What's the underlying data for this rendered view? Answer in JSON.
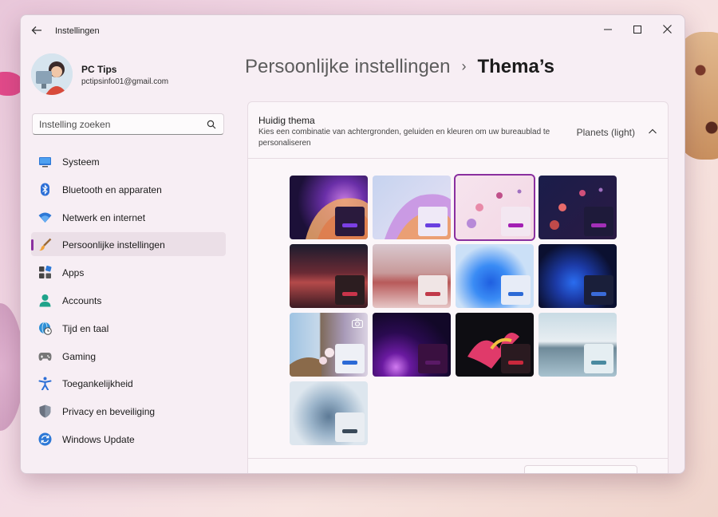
{
  "window": {
    "title": "Instellingen"
  },
  "profile": {
    "name": "PC Tips",
    "email": "pctipsinfo01@gmail.com"
  },
  "search": {
    "placeholder": "Instelling zoeken"
  },
  "nav": {
    "items": [
      {
        "label": "Systeem",
        "icon": "monitor-icon"
      },
      {
        "label": "Bluetooth en apparaten",
        "icon": "bluetooth-icon"
      },
      {
        "label": "Netwerk en internet",
        "icon": "wifi-icon"
      },
      {
        "label": "Persoonlijke instellingen",
        "icon": "brush-icon",
        "active": true
      },
      {
        "label": "Apps",
        "icon": "apps-icon"
      },
      {
        "label": "Accounts",
        "icon": "person-icon"
      },
      {
        "label": "Tijd en taal",
        "icon": "globe-clock-icon"
      },
      {
        "label": "Gaming",
        "icon": "gamepad-icon"
      },
      {
        "label": "Toegankelijkheid",
        "icon": "accessibility-icon"
      },
      {
        "label": "Privacy en beveiliging",
        "icon": "shield-icon"
      },
      {
        "label": "Windows Update",
        "icon": "update-icon"
      }
    ]
  },
  "breadcrumb": {
    "parent": "Persoonlijke instellingen",
    "separator": "›",
    "current": "Thema’s"
  },
  "current_theme": {
    "title": "Huidig thema",
    "description": "Kies een combinatie van achtergronden, geluiden en kleuren om uw bureaublad te personaliseren",
    "value": "Planets (light)"
  },
  "themes": [
    {
      "bg": "purple-wave-dark",
      "mini_bg": "#2a1a3d",
      "accent": "#7b3fe4"
    },
    {
      "bg": "purple-wave-light",
      "mini_bg": "#efe9f7",
      "accent": "#6a3fe0"
    },
    {
      "bg": "planets-light",
      "mini_bg": "#f3e7f1",
      "accent": "#a31fb3",
      "selected": true
    },
    {
      "bg": "planets-dark",
      "mini_bg": "#1e1a3a",
      "accent": "#a22fb8"
    },
    {
      "bg": "red-dunes-dark",
      "mini_bg": "#2c1d20",
      "accent": "#c9344a"
    },
    {
      "bg": "red-dunes-light",
      "mini_bg": "#f0e5e5",
      "accent": "#c13a4a"
    },
    {
      "bg": "bloom-light",
      "mini_bg": "#e7ecf7",
      "accent": "#2c6ad6"
    },
    {
      "bg": "bloom-dark",
      "mini_bg": "#1a1f3a",
      "accent": "#3a6bd8"
    },
    {
      "bg": "spotlight-flowers",
      "mini_bg": "#eef0f6",
      "accent": "#2c6ad6",
      "camera": true
    },
    {
      "bg": "glow",
      "mini_bg": "#3a1040",
      "accent": "#5a1a66"
    },
    {
      "bg": "captured-motion",
      "mini_bg": "#2a1a20",
      "accent": "#c9283c"
    },
    {
      "bg": "flow-lake",
      "mini_bg": "#e5eef2",
      "accent": "#4a8aa0"
    },
    {
      "bg": "sunrise-grey",
      "mini_bg": "#e9edf2",
      "accent": "#3a4a5a"
    }
  ],
  "colors": {
    "accent": "#8a2f9f",
    "window_bg": "#f7eef4"
  }
}
